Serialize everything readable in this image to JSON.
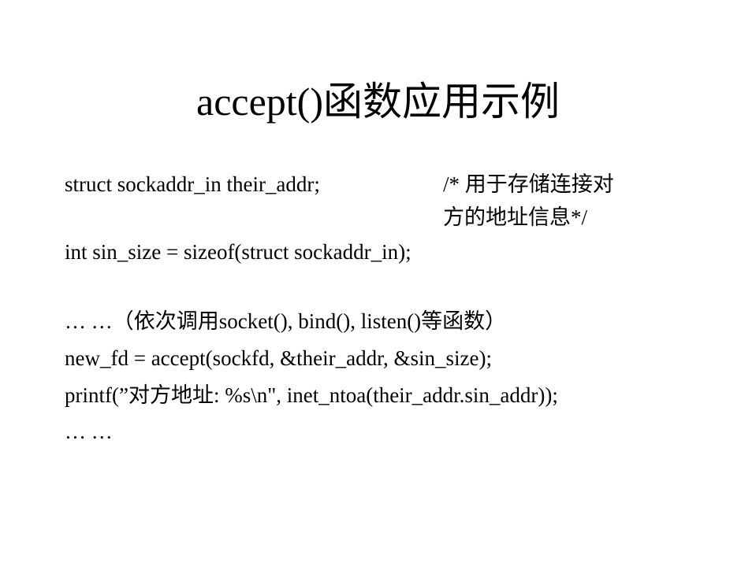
{
  "slide": {
    "title": "accept()函数应用示例",
    "code": {
      "line1": "struct sockaddr_in their_addr;",
      "comment_line1": "/* 用于存储连接对",
      "comment_line2": "方的地址信息*/",
      "line2": "int sin_size = sizeof(struct sockaddr_in);",
      "line3": "… …（依次调用socket(), bind(), listen()等函数）",
      "line4": "new_fd = accept(sockfd, &their_addr, &sin_size);",
      "line5": "printf(”对方地址: %s\\n\", inet_ntoa(their_addr.sin_addr));",
      "line6": "… …"
    }
  }
}
